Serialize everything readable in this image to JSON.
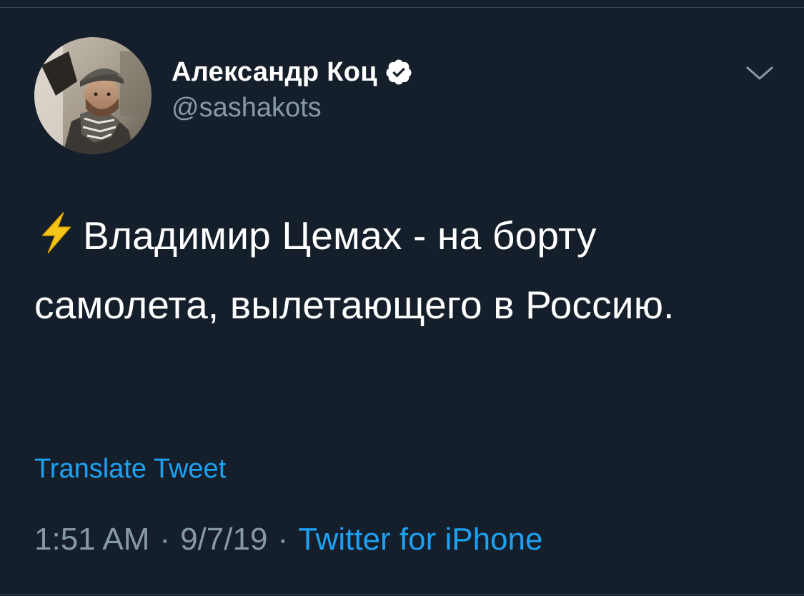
{
  "tweet": {
    "author": {
      "display_name": "Александр Коц",
      "handle": "@sashakots",
      "verified": true,
      "avatar_icon": "user-avatar-photo",
      "verified_icon": "verified-badge-icon"
    },
    "menu_icon": "chevron-down-icon",
    "text": {
      "emoji_icon": "lightning-bolt-icon",
      "body": "Владимир Цемах - на борту самолета, вылетающего в Россию."
    },
    "translate_label": "Translate Tweet",
    "meta": {
      "time": "1:51 AM",
      "separator": "·",
      "date": "9/7/19",
      "source": "Twitter for iPhone"
    }
  },
  "colors": {
    "background": "#151f2b",
    "primary_text": "#ffffff",
    "secondary_text": "#8899a6",
    "accent": "#1da1f2",
    "divider": "#37444f",
    "emoji": "#f5c518"
  }
}
